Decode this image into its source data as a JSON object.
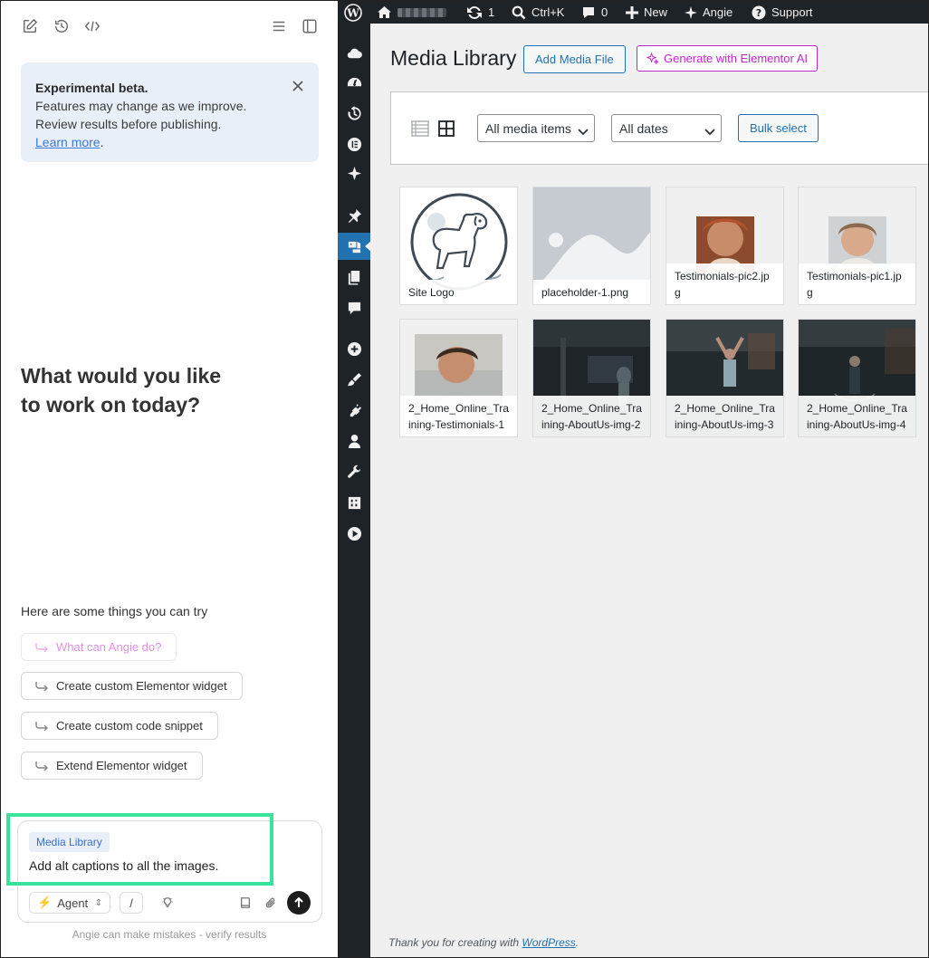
{
  "left_panel": {
    "notice": {
      "title": "Experimental beta.",
      "line1": "Features may change as we improve.",
      "line2": "Review results before publishing.",
      "link": "Learn more",
      "link_suffix": "."
    },
    "hero_line1": "What would you like",
    "hero_line2": "to work on today?",
    "try_label": "Here are some things you can try",
    "suggestions": [
      "What can Angie do?",
      "Create custom Elementor widget",
      "Create custom code snippet",
      "Extend Elementor widget"
    ],
    "composer": {
      "context_chip": "Media Library",
      "prompt": "Add alt captions to all the images.",
      "mode": "Agent",
      "slash": "/"
    },
    "disclaimer": "Angie can make mistakes - verify results"
  },
  "admin_bar": {
    "updates_count": "1",
    "search_shortcut": "Ctrl+K",
    "comments_count": "0",
    "new_label": "New",
    "angie_label": "Angie",
    "support_label": "Support"
  },
  "media": {
    "page_title": "Media Library",
    "add_button": "Add Media File",
    "ai_button": "Generate with Elementor AI",
    "filter_type": "All media items",
    "filter_date": "All dates",
    "bulk_select": "Bulk select",
    "items": [
      {
        "caption": "Site Logo"
      },
      {
        "caption": "placeholder-1.png"
      },
      {
        "caption": "Testimonials-pic2.jpg"
      },
      {
        "caption": "Testimonials-pic1.jpg"
      },
      {
        "caption": "2_Home_Online_Training-Testimonials-1"
      },
      {
        "caption": "2_Home_Online_Training-AboutUs-img-2"
      },
      {
        "caption": "2_Home_Online_Training-AboutUs-img-3"
      },
      {
        "caption": "2_Home_Online_Training-AboutUs-img-4"
      }
    ],
    "footer_text": "Thank you for creating with ",
    "footer_link": "WordPress",
    "footer_suffix": "."
  },
  "colors": {
    "admin_dark": "#1d2327",
    "wp_blue": "#2271b1",
    "elementor_ai": "#c126c8",
    "highlight": "#38e39a"
  }
}
